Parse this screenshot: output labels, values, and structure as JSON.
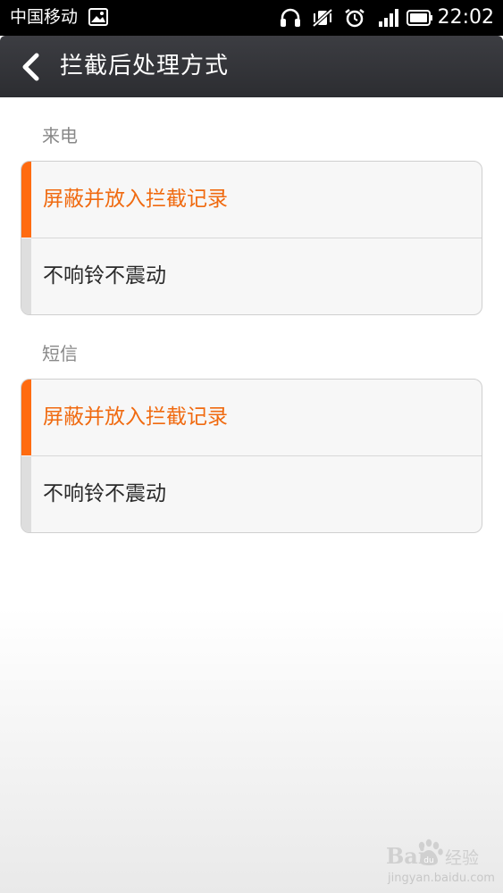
{
  "status_bar": {
    "carrier": "中国移动",
    "time": "22:02",
    "icons": [
      "image-notification-icon",
      "headset-icon",
      "vibrate-off-icon",
      "alarm-icon",
      "signal-icon",
      "battery-icon"
    ]
  },
  "title_bar": {
    "title": "拦截后处理方式",
    "back_icon": "chevron-left-icon"
  },
  "sections": [
    {
      "label": "来电",
      "options": [
        {
          "label": "屏蔽并放入拦截记录",
          "selected": true
        },
        {
          "label": "不响铃不震动",
          "selected": false
        }
      ]
    },
    {
      "label": "短信",
      "options": [
        {
          "label": "屏蔽并放入拦截记录",
          "selected": true
        },
        {
          "label": "不响铃不震动",
          "selected": false
        }
      ]
    }
  ],
  "watermark": {
    "brand": "Bai",
    "name": "经验",
    "domain": "jingyan.baidu.com"
  },
  "colors": {
    "accent": "#ff6b10",
    "title_bar": "#333438",
    "status_bar": "#000000"
  }
}
